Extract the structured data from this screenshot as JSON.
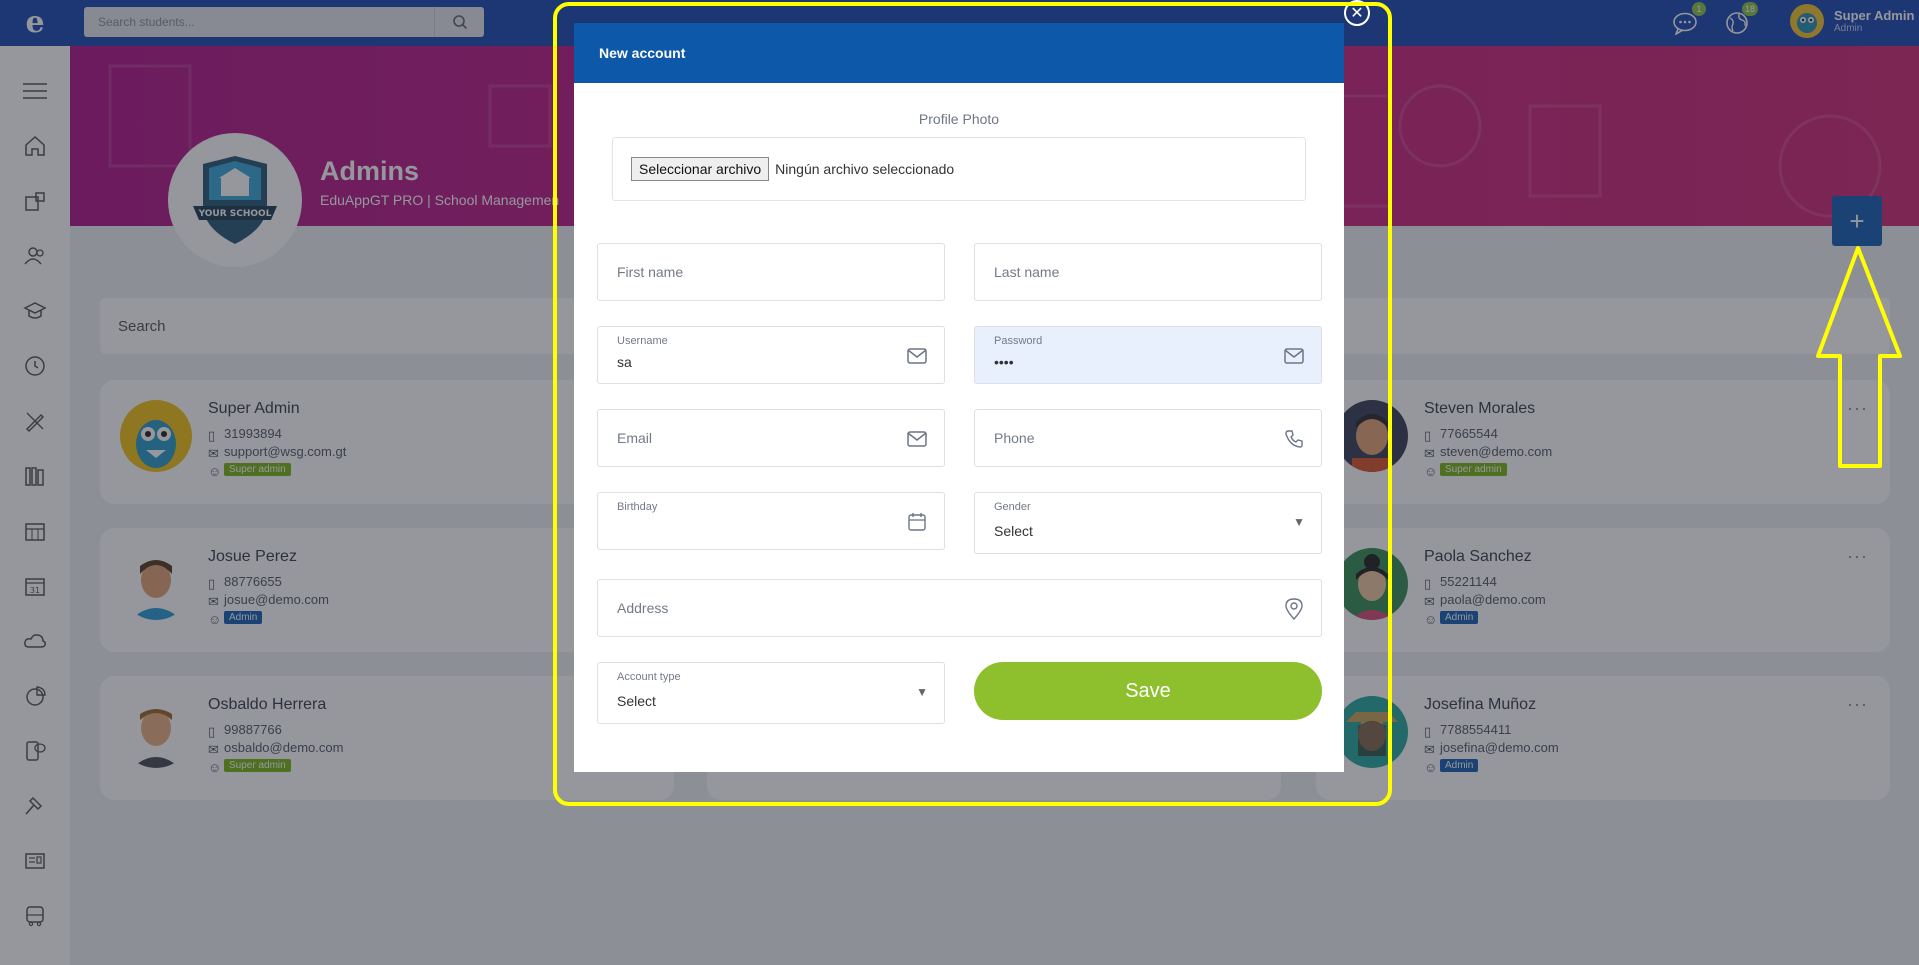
{
  "topbar": {
    "search_placeholder": "Search students...",
    "messages_badge": "1",
    "notifications_badge": "18",
    "user_name": "Super Admin",
    "user_role": "Admin"
  },
  "header": {
    "title": "Admins",
    "subtitle": "EduAppGT PRO | School Managemen",
    "search_placeholder": "Search"
  },
  "cards": [
    {
      "name": "Super Admin",
      "phone": "31993894",
      "email": "support@wsg.com.gt",
      "role": "Super admin",
      "role_color": "#7cb518"
    },
    {
      "name": "Steven Morales",
      "phone": "77665544",
      "email": "steven@demo.com",
      "role": "Super admin",
      "role_color": "#7cb518"
    },
    {
      "name": "Josue Perez",
      "phone": "88776655",
      "email": "josue@demo.com",
      "role": "Admin",
      "role_color": "#1a5fb4"
    },
    {
      "name": "Paola Sanchez",
      "phone": "55221144",
      "email": "paola@demo.com",
      "role": "Admin",
      "role_color": "#1a5fb4"
    },
    {
      "name": "Osbaldo Herrera",
      "phone": "99887766",
      "email": "osbaldo@demo.com",
      "role": "Super admin",
      "role_color": "#7cb518"
    },
    {
      "name": "Josefina Muñoz",
      "phone": "7788554411",
      "email": "josefina@demo.com",
      "role": "Admin",
      "role_color": "#1a5fb4"
    }
  ],
  "modal": {
    "title": "New account",
    "profile_photo_label": "Profile Photo",
    "file_button": "Seleccionar archivo",
    "file_status": "Ningún archivo seleccionado",
    "first_name_placeholder": "First name",
    "last_name_placeholder": "Last name",
    "username_label": "Username",
    "username_value": "sa",
    "password_label": "Password",
    "password_value": "••••",
    "email_placeholder": "Email",
    "phone_placeholder": "Phone",
    "birthday_label": "Birthday",
    "gender_label": "Gender",
    "gender_value": "Select",
    "address_placeholder": "Address",
    "account_type_label": "Account type",
    "account_type_value": "Select",
    "save_label": "Save"
  },
  "colors": {
    "topbar": "#1d49b3",
    "modal_header": "#0d58a8",
    "save": "#8ec02e",
    "highlight": "#ffff00"
  },
  "school_logo_text": "YOUR SCHOOL"
}
